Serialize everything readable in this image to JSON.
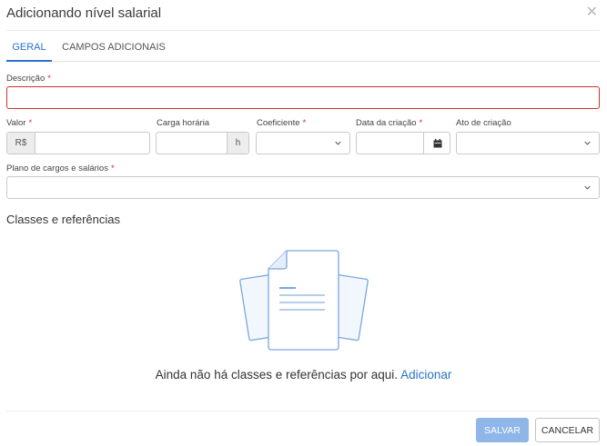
{
  "modal": {
    "title": "Adicionando nível salarial",
    "close_label": "✕"
  },
  "tabs": [
    {
      "label": "GERAL",
      "active": true
    },
    {
      "label": "CAMPOS ADICIONAIS",
      "active": false
    }
  ],
  "form": {
    "descricao": {
      "label": "Descrição",
      "required_mark": "*",
      "value": ""
    },
    "valor": {
      "label": "Valor",
      "required_mark": "*",
      "prefix": "R$",
      "value": ""
    },
    "carga_horaria": {
      "label": "Carga horária",
      "suffix": "h",
      "value": ""
    },
    "coeficiente": {
      "label": "Coeficiente",
      "required_mark": "*",
      "selected": ""
    },
    "data_criacao": {
      "label": "Data da criação",
      "required_mark": "*",
      "value": ""
    },
    "ato_criacao": {
      "label": "Ato de criação",
      "selected": ""
    },
    "plano": {
      "label": "Plano de cargos e salários",
      "required_mark": "*",
      "selected": ""
    }
  },
  "classes": {
    "title": "Classes e referências",
    "empty_text": "Ainda não há classes e referências por aqui.",
    "add_link": "Adicionar"
  },
  "footer": {
    "save_label": "SALVAR",
    "cancel_label": "CANCELAR"
  },
  "colors": {
    "accent": "#2a72c9",
    "required": "#d0312d",
    "save_disabled": "#8fb6e8"
  }
}
